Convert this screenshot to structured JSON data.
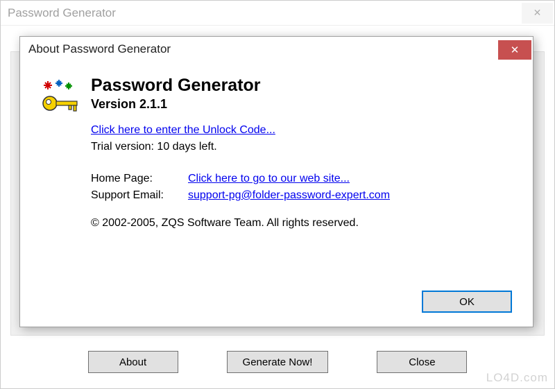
{
  "main_window": {
    "title": "Password Generator",
    "close_glyph": "✕",
    "buttons": {
      "about": "About",
      "generate": "Generate Now!",
      "close": "Close"
    }
  },
  "about_dialog": {
    "title": "About Password Generator",
    "close_glyph": "✕",
    "app_name": "Password Generator",
    "version_label": "Version 2.1.1",
    "unlock_link": "Click here to enter the Unlock Code...",
    "trial_text": "Trial version: 10 days left.",
    "home_page_label": "Home Page:",
    "home_page_link": "Click here to go to our web site...",
    "support_label": "Support Email:",
    "support_email": "support-pg@folder-password-expert.com",
    "copyright": "© 2002-2005, ZQS Software Team. All rights reserved.",
    "ok_label": "OK"
  },
  "watermark": "LO4D.com"
}
